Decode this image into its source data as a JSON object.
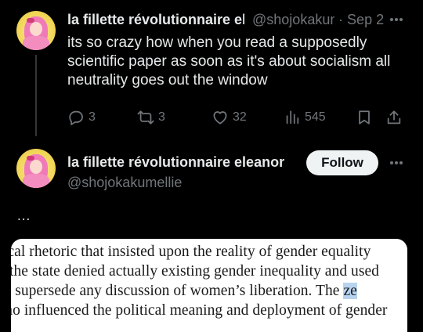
{
  "post1": {
    "display_name": "la fillette révolutionnaire eleanor",
    "handle": "@shojokakumellie",
    "separator": "·",
    "date": "Sep 2",
    "text": "its so crazy how when you read a supposedly scientific paper as soon as it's about socialism all neutrality goes out the window",
    "actions": {
      "reply_count": "3",
      "repost_count": "3",
      "like_count": "32",
      "view_count": "545"
    }
  },
  "post2": {
    "display_name": "la fillette révolutionnaire eleanor",
    "handle": "@shojokakumellie",
    "follow_label": "Follow",
    "text": "...",
    "paper_lines": [
      "political rhetoric that insisted upon the reality of gender equality",
      "the state denied actually existing gender inequality and used",
      "to supersede any discussion of women’s liberation. The ",
      "Mao influenced the political meaning and deployment of gender"
    ],
    "paper_highlight": "ze"
  },
  "colors": {
    "background": "#000000",
    "text_primary": "#e7e9ea",
    "text_secondary": "#71767b",
    "divider": "#333639",
    "follow_bg": "#eff3f4",
    "highlight": "#b7d3ef"
  },
  "icons": [
    "avatar-image",
    "more-icon",
    "reply-icon",
    "repost-icon",
    "like-icon",
    "views-icon",
    "bookmark-icon",
    "share-icon"
  ]
}
